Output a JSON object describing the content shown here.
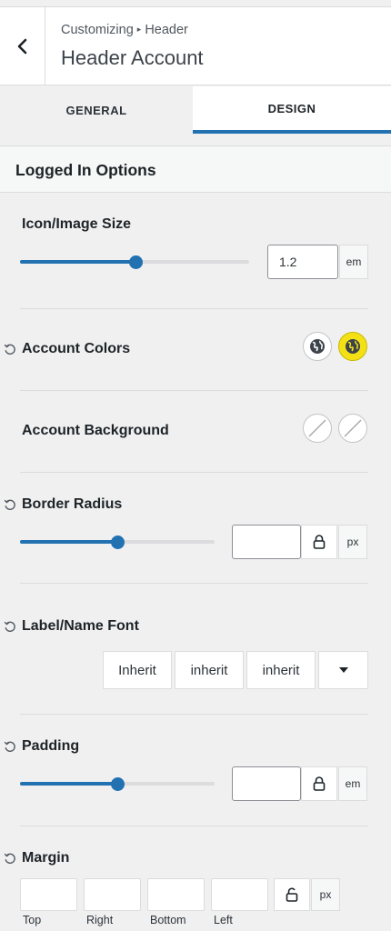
{
  "header": {
    "breadcrumb_parent": "Customizing",
    "breadcrumb_child": "Header",
    "title": "Header Account"
  },
  "tabs": [
    {
      "label": "GENERAL",
      "active": false
    },
    {
      "label": "DESIGN",
      "active": true
    }
  ],
  "section": {
    "title": "Logged In Options"
  },
  "icon_size": {
    "label": "Icon/Image Size",
    "value": "1.2",
    "unit": "em",
    "slider_fraction": 0.5
  },
  "account_colors": {
    "label": "Account Colors",
    "swatches": [
      "#ffffff",
      "#f3e116"
    ]
  },
  "account_background": {
    "label": "Account Background"
  },
  "border_radius": {
    "label": "Border Radius",
    "value": "",
    "unit": "px",
    "slider_fraction": 0.5
  },
  "label_font": {
    "label": "Label/Name Font",
    "family": "Inherit",
    "weight": "inherit",
    "style": "inherit"
  },
  "padding": {
    "label": "Padding",
    "value": "",
    "unit": "em",
    "slider_fraction": 0.5
  },
  "margin": {
    "label": "Margin",
    "unit": "px",
    "fields": [
      "Top",
      "Right",
      "Bottom",
      "Left"
    ]
  },
  "colors": {
    "accent": "#2271b1",
    "highlight": "#f3e116"
  }
}
